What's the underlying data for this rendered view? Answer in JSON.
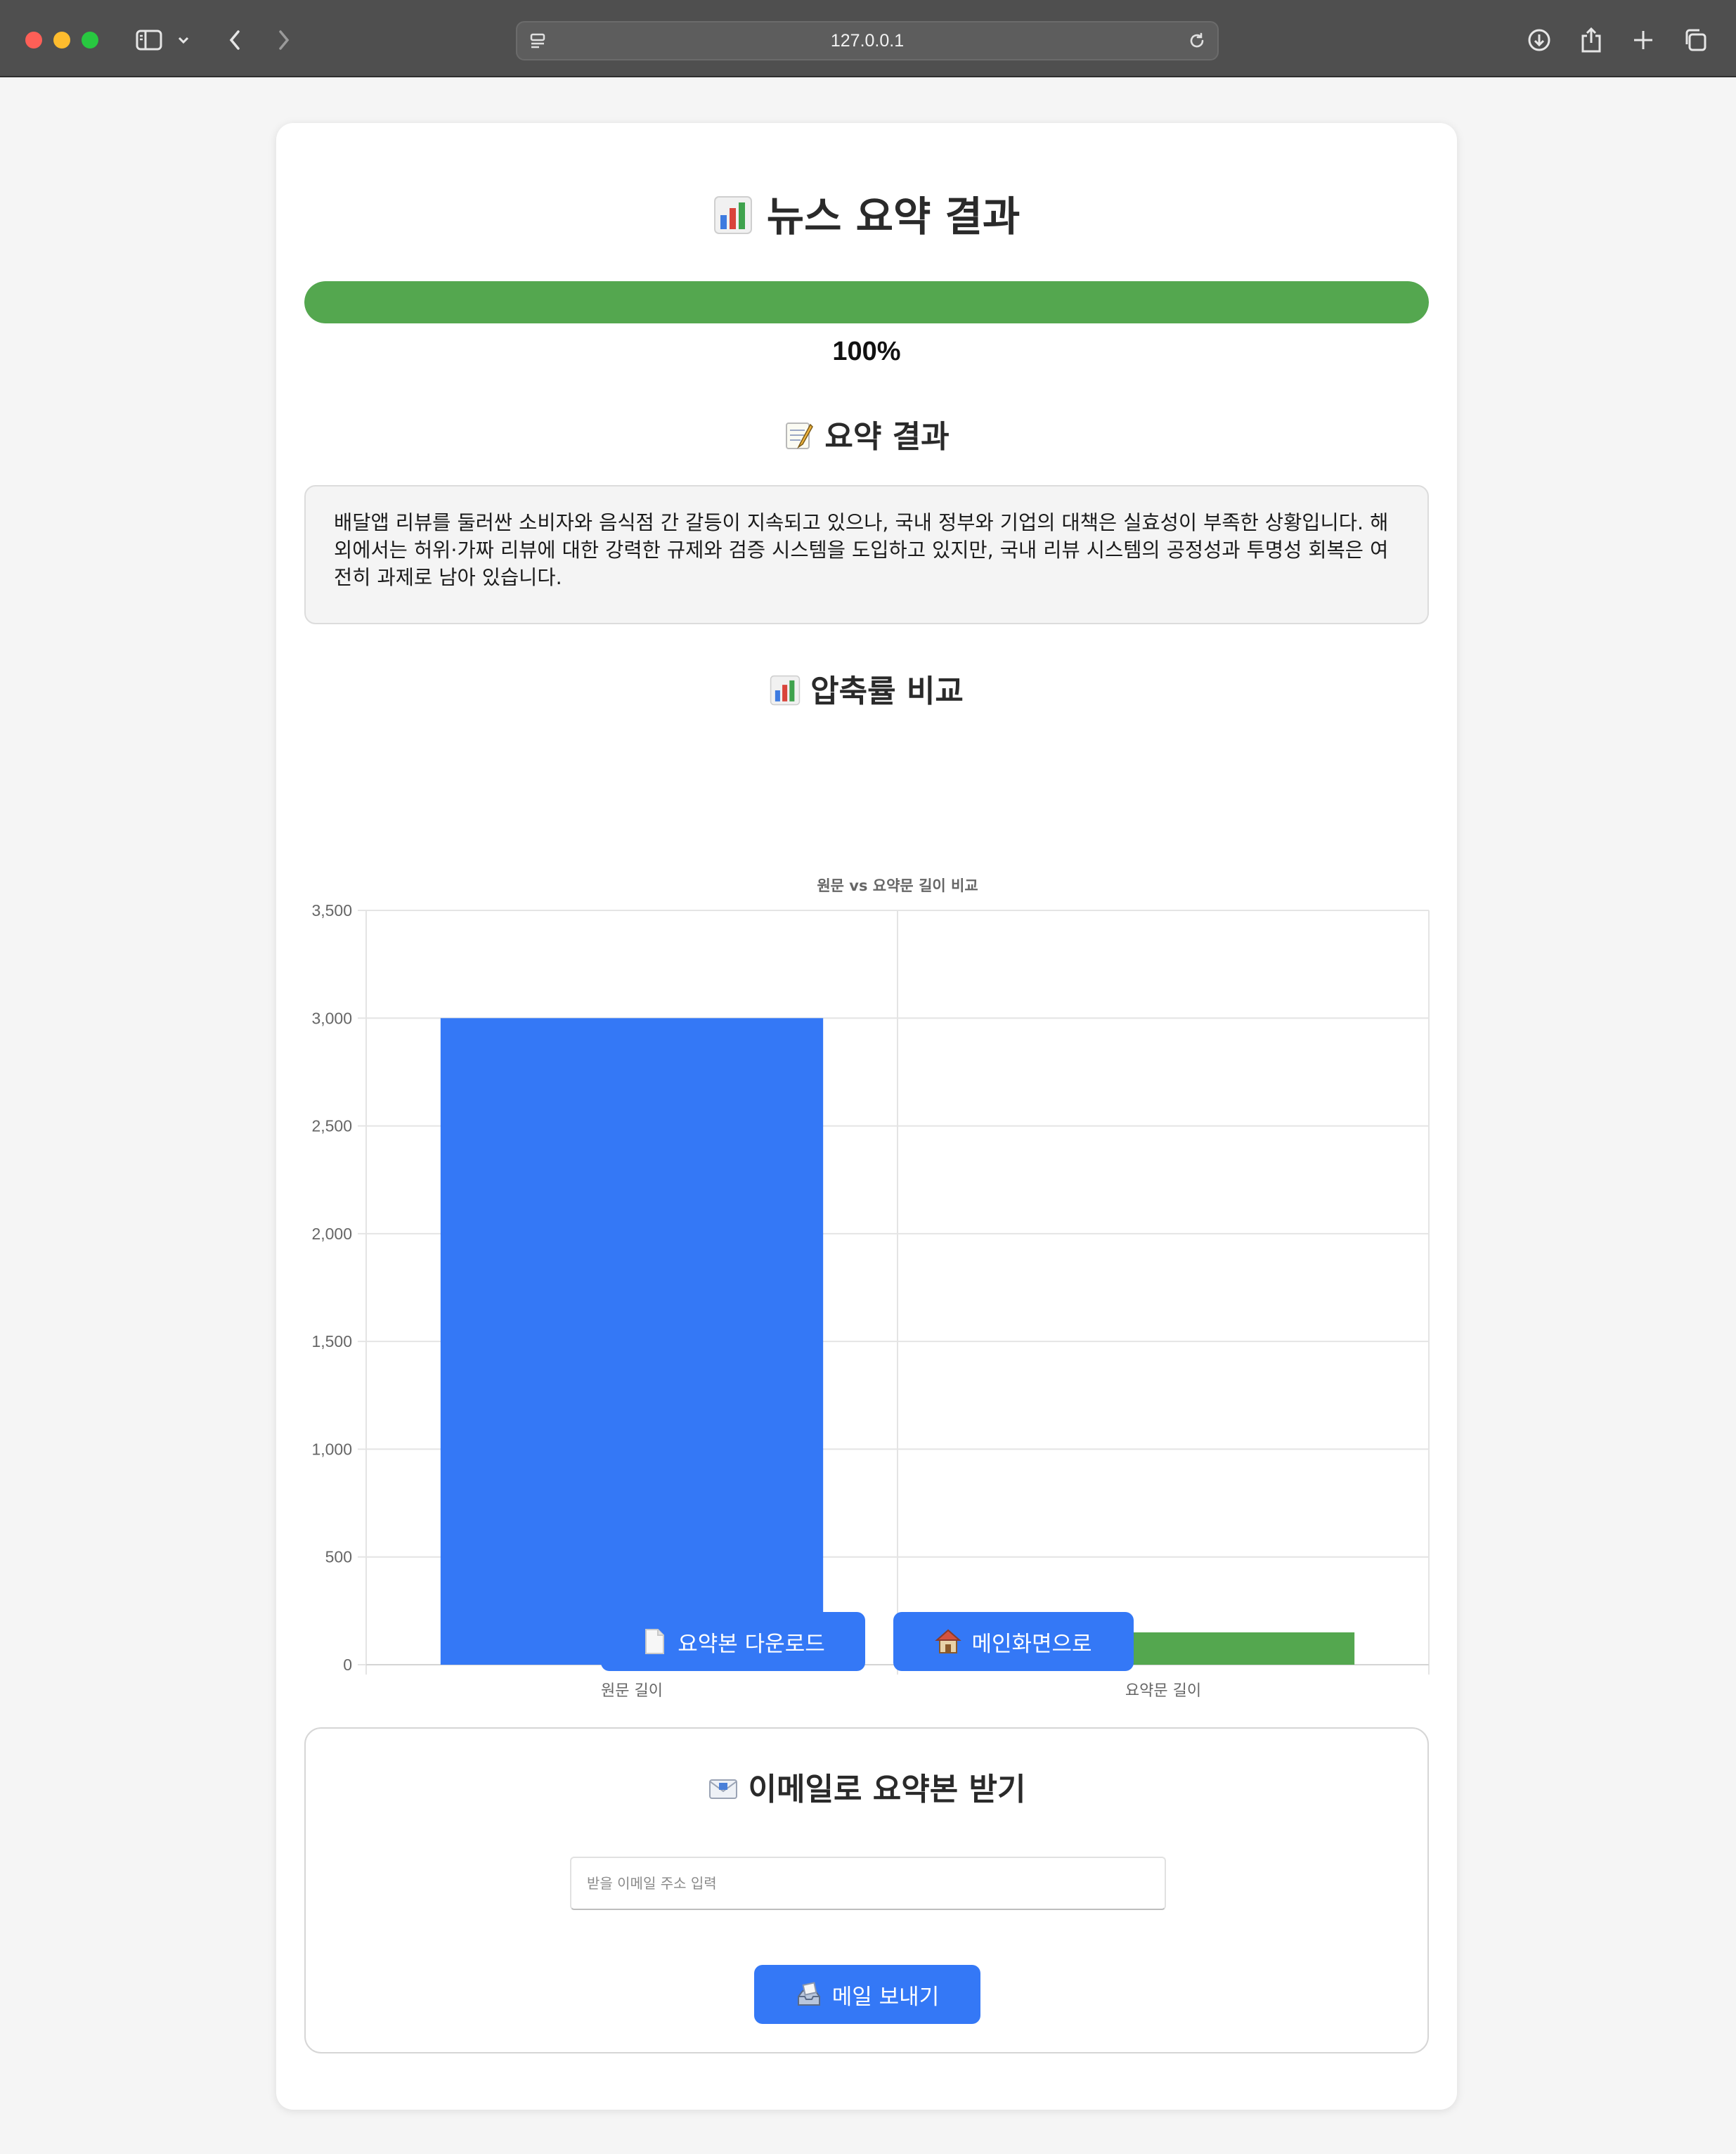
{
  "browser": {
    "url": "127.0.0.1"
  },
  "page": {
    "title": "뉴스 요약 결과",
    "progress": {
      "value": 100,
      "label": "100%"
    },
    "summary_heading": "요약 결과",
    "summary_text": "배달앱 리뷰를 둘러싼 소비자와 음식점 간 갈등이 지속되고 있으나, 국내 정부와 기업의 대책은 실효성이 부족한 상황입니다. 해외에서는 허위·가짜 리뷰에 대한 강력한 규제와 검증 시스템을 도입하고 있지만, 국내 리뷰 시스템의 공정성과 투명성 회복은 여전히 과제로 남아 있습니다.",
    "chart_heading": "압축률 비교",
    "buttons": {
      "download": "요약본 다운로드",
      "home": "메인화면으로"
    },
    "email": {
      "heading": "이메일로 요약본 받기",
      "placeholder": "받을 이메일 주소 입력",
      "value": "",
      "send": "메일 보내기"
    }
  },
  "chart_data": {
    "type": "bar",
    "title": "원문 vs 요약문 길이 비교",
    "categories": [
      "원문 길이",
      "요약문 길이"
    ],
    "values": [
      3000,
      150
    ],
    "colors": [
      "#3478f6",
      "#54a74f"
    ],
    "ylim": [
      0,
      3500
    ],
    "yticks": [
      0,
      500,
      1000,
      1500,
      2000,
      2500,
      3000,
      3500
    ],
    "ytick_labels": [
      "0",
      "500",
      "1,000",
      "1,500",
      "2,000",
      "2,500",
      "3,000",
      "3,500"
    ],
    "grid": true,
    "legend": "none"
  },
  "icons": {
    "chart": "bar-chart-icon",
    "memo": "memo-icon",
    "document": "document-icon",
    "house": "house-icon",
    "envelope": "envelope-icon",
    "send": "outbox-tray-icon"
  }
}
